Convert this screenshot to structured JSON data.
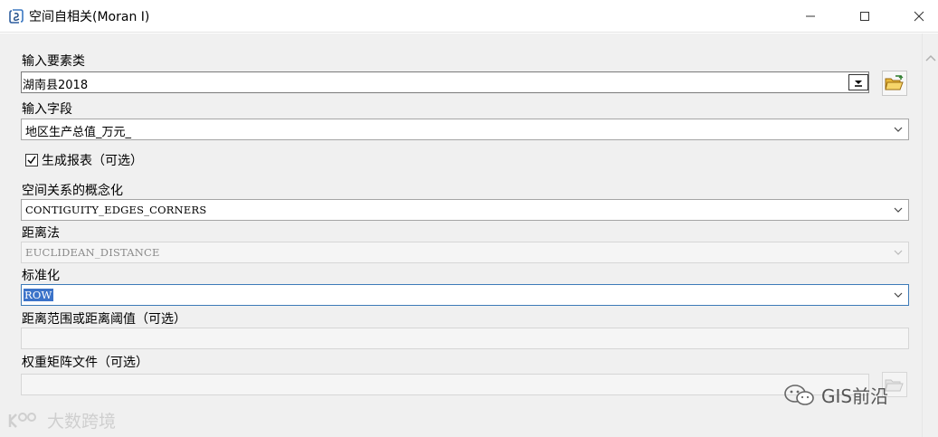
{
  "window": {
    "title": "空间自相关(Moran I)",
    "icon": "arctoolbox-script-icon",
    "controls": [
      "minimize-icon",
      "maximize-icon",
      "close-icon"
    ]
  },
  "params": {
    "input_features": {
      "label": "输入要素类",
      "value": "湖南县2018"
    },
    "input_field": {
      "label": "输入字段",
      "value": "地区生产总值_万元_"
    },
    "generate_report": {
      "label": "生成报表（可选）",
      "checked": true
    },
    "conceptualization": {
      "label": "空间关系的概念化",
      "value": "CONTIGUITY_EDGES_CORNERS"
    },
    "distance_method": {
      "label": "距离法",
      "value": "EUCLIDEAN_DISTANCE"
    },
    "standardization": {
      "label": "标准化",
      "value": "ROW"
    },
    "distance_threshold": {
      "label": "距离范围或距离阈值（可选）",
      "value": ""
    },
    "weights_file": {
      "label": "权重矩阵文件（可选）",
      "value": ""
    }
  },
  "watermarks": {
    "left": "大数跨境",
    "right": "GIS前沿"
  }
}
